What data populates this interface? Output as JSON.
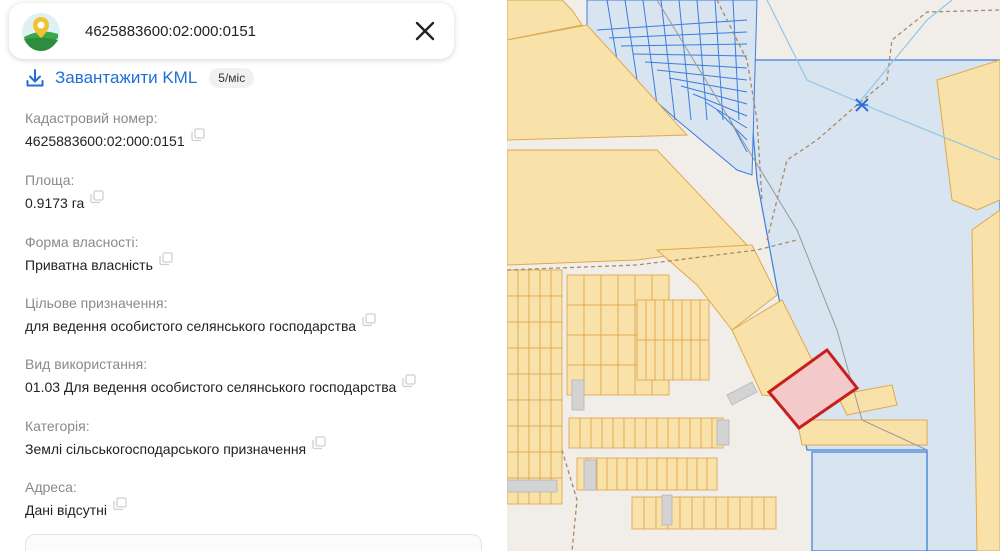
{
  "search": {
    "value": "4625883600:02:000:0151",
    "logo": "app-logo",
    "close_icon": "close-icon"
  },
  "kml": {
    "label": "Завантажити KML",
    "badge": "5/міс",
    "icon": "download-icon"
  },
  "fields": [
    {
      "label": "Кадастровий номер:",
      "value": "4625883600:02:000:0151"
    },
    {
      "label": "Площа:",
      "value": "0.9173 га"
    },
    {
      "label": "Форма власності:",
      "value": "Приватна власність"
    },
    {
      "label": "Цільове призначення:",
      "value": "для ведення особистого селянського господарства"
    },
    {
      "label": "Вид використання:",
      "value": "01.03 Для ведення особистого селянського господарства"
    },
    {
      "label": "Категорія:",
      "value": "Землі сільськогосподарського призначення"
    },
    {
      "label": "Адреса:",
      "value": "Дані відсутні"
    }
  ],
  "map": {
    "parcel_fill": "#f9e2a9",
    "parcel_stroke": "#e0a84e",
    "blue_stroke": "#3b7de0",
    "water_fill": "#d8e4ef",
    "selected_stroke": "#c81e1e",
    "selected_fill": "#f3c9c9"
  }
}
